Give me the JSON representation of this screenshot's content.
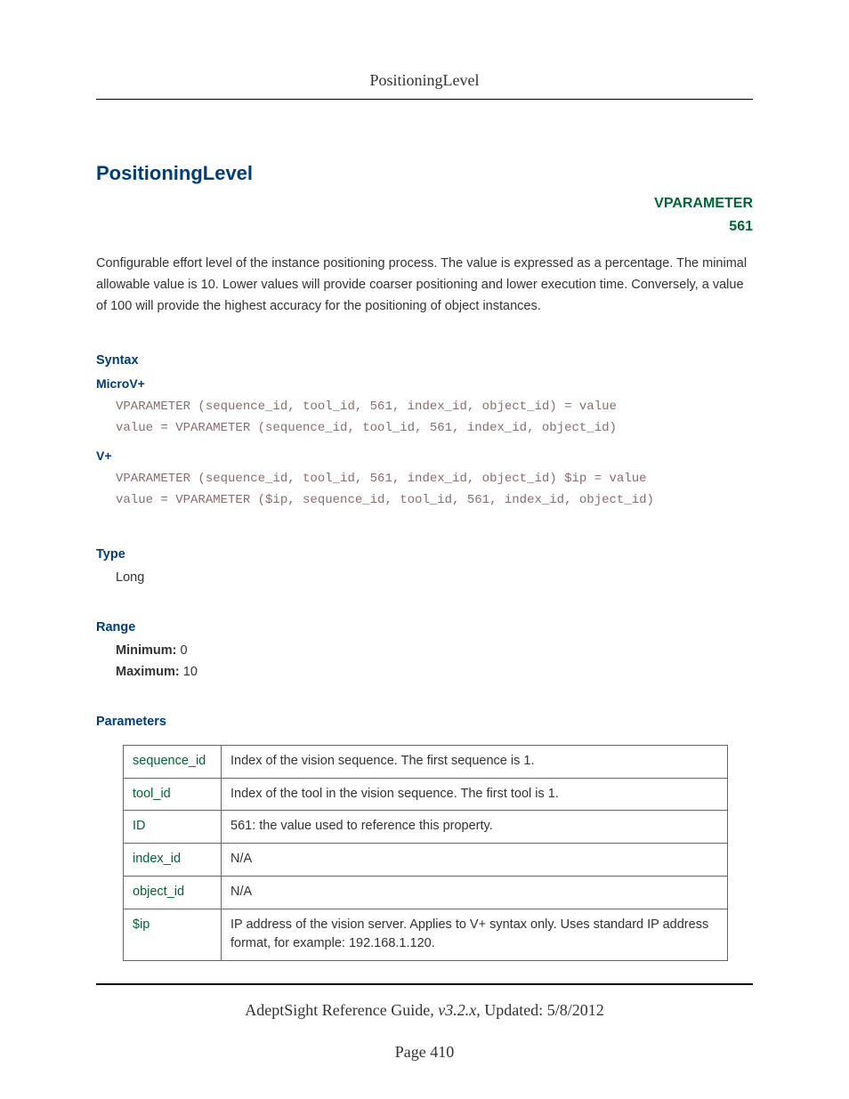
{
  "header": {
    "running": "PositioningLevel"
  },
  "title": "PositioningLevel",
  "badge": {
    "label": "VPARAMETER",
    "id": "561"
  },
  "description": "Configurable effort level of the instance positioning process. The value is expressed as a percentage. The minimal allowable value is 10. Lower values will provide coarser positioning and lower execution time. Conversely, a value of 100 will provide the highest accuracy for the positioning of object instances.",
  "syntax": {
    "heading": "Syntax",
    "microv": {
      "label": "MicroV+",
      "line1": "VPARAMETER (sequence_id, tool_id, 561, index_id, object_id) = value",
      "line2": "value = VPARAMETER (sequence_id, tool_id, 561, index_id, object_id)"
    },
    "vplus": {
      "label": "V+",
      "line1": "VPARAMETER (sequence_id, tool_id, 561, index_id, object_id) $ip = value",
      "line2": "value = VPARAMETER ($ip, sequence_id, tool_id, 561, index_id, object_id)"
    }
  },
  "type": {
    "heading": "Type",
    "value": "Long"
  },
  "range": {
    "heading": "Range",
    "min_label": "Minimum:",
    "min_value": "0",
    "max_label": "Maximum:",
    "max_value": "10"
  },
  "parameters": {
    "heading": "Parameters",
    "rows": [
      {
        "name": "sequence_id",
        "desc": "Index of the vision sequence. The first sequence is 1."
      },
      {
        "name": "tool_id",
        "desc": "Index of the tool in the vision sequence. The first tool is 1."
      },
      {
        "name": "ID",
        "desc": "561: the value used to reference this property."
      },
      {
        "name": "index_id",
        "desc": "N/A"
      },
      {
        "name": "object_id",
        "desc": "N/A"
      },
      {
        "name": "$ip",
        "desc": "IP address of the vision server. Applies to V+ syntax only. Uses standard IP address format, for example: 192.168.1.120."
      }
    ]
  },
  "footer": {
    "guide": "AdeptSight Reference Guide",
    "sep": ", ",
    "version": "v3.2.x",
    "updated_label": ", Updated: ",
    "updated": "5/8/2012",
    "page_label": "Page ",
    "page": "410"
  }
}
